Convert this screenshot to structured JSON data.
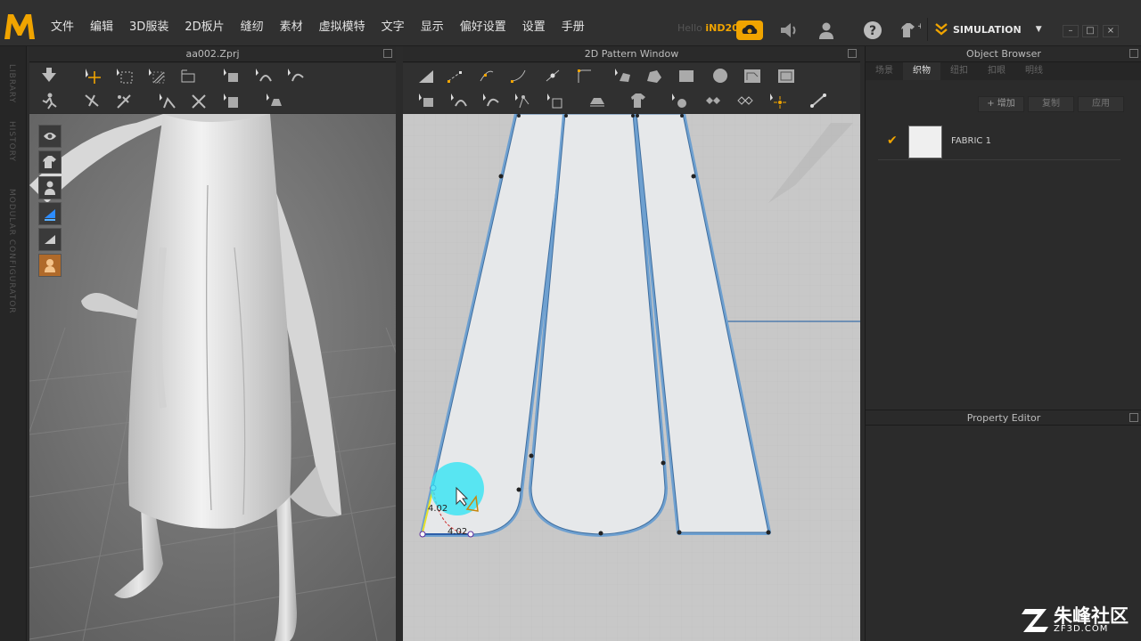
{
  "app": {
    "logo_letter": "M",
    "license_prefix": "Hello",
    "license_name": "iND2018",
    "simulation_label": "SIMULATION",
    "accent_color": "#f0a400"
  },
  "menu": {
    "items": [
      "文件",
      "编辑",
      "3D服装",
      "2D板片",
      "缝纫",
      "素材",
      "虚拟模特",
      "文字",
      "显示",
      "偏好设置",
      "设置",
      "手册"
    ]
  },
  "sidebar": {
    "labels": [
      "LIBRARY",
      "HISTORY",
      "MODULAR CONFIGURATOR"
    ]
  },
  "view3d": {
    "title": "aa002.Zprj"
  },
  "view2d": {
    "title": "2D Pattern Window",
    "measure_vertical": "4.02",
    "measure_horizontal": "4.02"
  },
  "object_browser": {
    "title": "Object Browser",
    "tabs": [
      "场景",
      "织物",
      "纽扣",
      "扣眼",
      "明线"
    ],
    "active_tab": "织物",
    "actions": [
      "+ 增加",
      "复制",
      "应用"
    ],
    "fabric_name": "FABRIC 1"
  },
  "property_editor": {
    "title": "Property Editor"
  },
  "watermark": {
    "main": "朱峰社区",
    "sub": "ZF3D.COM"
  }
}
